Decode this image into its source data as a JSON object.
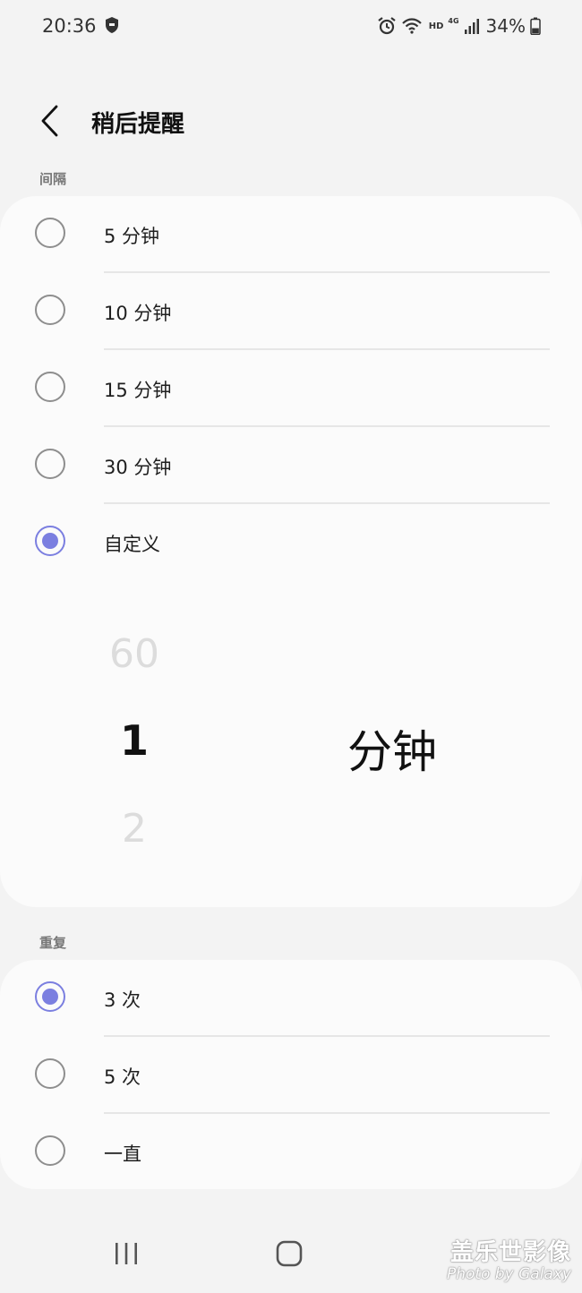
{
  "status_bar": {
    "time": "20:36",
    "hd": "HD",
    "network": "4G",
    "battery": "34%",
    "icons": [
      "shield-icon",
      "alarm-icon",
      "wifi-icon",
      "signal-icon",
      "battery-icon"
    ]
  },
  "header": {
    "title": "稍后提醒"
  },
  "interval": {
    "label": "间隔",
    "options": [
      {
        "label": "5 分钟",
        "checked": false
      },
      {
        "label": "10 分钟",
        "checked": false
      },
      {
        "label": "15 分钟",
        "checked": false
      },
      {
        "label": "30 分钟",
        "checked": false
      },
      {
        "label": "自定义",
        "checked": true
      }
    ],
    "picker": {
      "above": "60",
      "current": "1",
      "below": "2",
      "unit": "分钟"
    }
  },
  "repeat": {
    "label": "重复",
    "options": [
      {
        "label": "3 次",
        "checked": true
      },
      {
        "label": "5 次",
        "checked": false
      },
      {
        "label": "一直",
        "checked": false
      }
    ]
  },
  "watermark": {
    "title": "盖乐世影像",
    "subtitle": "Photo by Galaxy"
  },
  "colors": {
    "accent": "#7b7fe0",
    "background": "#f3f3f3",
    "card": "#fbfbfb"
  }
}
